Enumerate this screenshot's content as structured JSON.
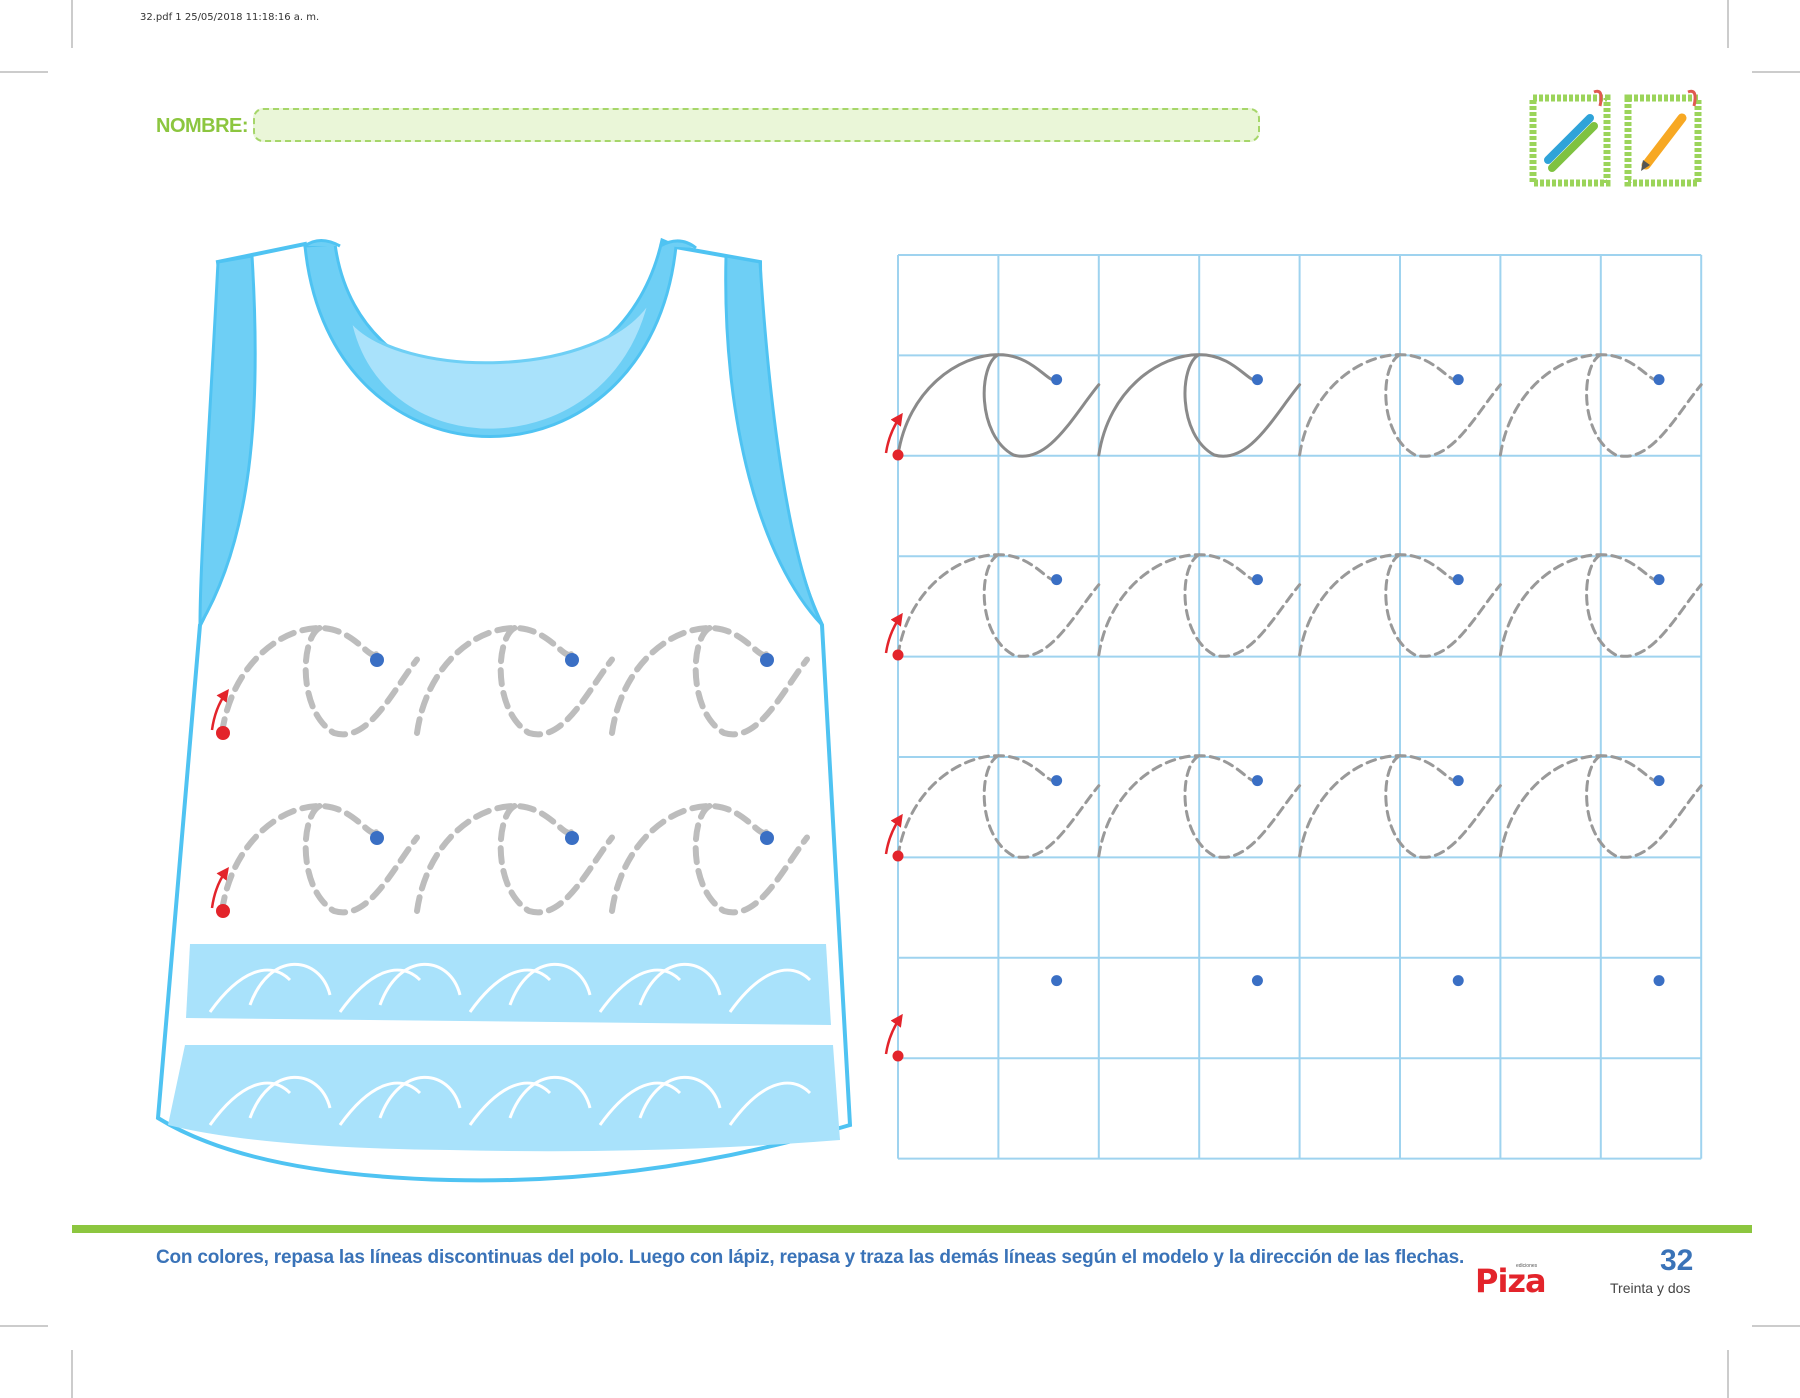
{
  "print_info": "32.pdf   1   25/05/2018   11:18:16 a. m.",
  "header": {
    "name_label": "NOMBRE:",
    "icons": [
      "colored-pencils-icon",
      "pencil-icon"
    ]
  },
  "footer": {
    "instruction": "Con colores, repasa las líneas discontinuas del polo. Luego con lápiz, repasa y traza las demás líneas según el modelo y la dirección de las flechas.",
    "brand_small": "ediciones",
    "brand": "Piza",
    "page_number": "32",
    "page_number_words": "Treinta y dos"
  },
  "colors": {
    "brand_green": "#8cc63f",
    "title_blue": "#3a73b8",
    "grid_blue": "#9fd3ef",
    "shirt_blue": "#6ecff5",
    "shirt_light_blue": "#a9e2fb",
    "dot_blue": "#3a6fc4",
    "start_red": "#e3242b",
    "trace_gray": "#999999"
  }
}
